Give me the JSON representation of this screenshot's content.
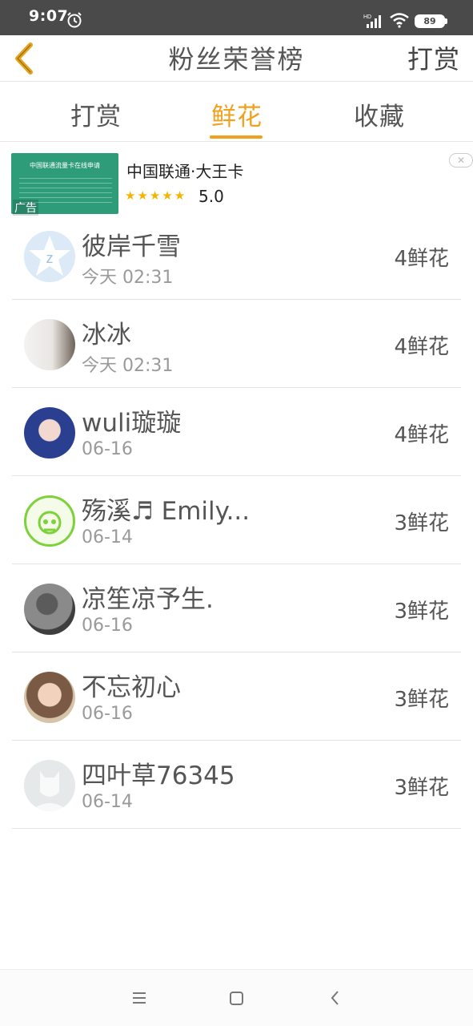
{
  "status_bar": {
    "time": "9:07",
    "network": "HD",
    "battery": "89"
  },
  "nav": {
    "back_icon": "chevron-left-icon",
    "title": "粉丝荣誉榜",
    "right_label": "打赏"
  },
  "tabs": [
    {
      "label": "打赏",
      "active": false
    },
    {
      "label": "鲜花",
      "active": true
    },
    {
      "label": "收藏",
      "active": false
    }
  ],
  "ad": {
    "title": "中国联通·大王卡",
    "stars": "★★★★★",
    "rating": "5.0",
    "badge": "广告",
    "image_heading": "中国联通流量卡在线申请"
  },
  "fans": [
    {
      "name": "彼岸千雪",
      "time": "今天 02:31",
      "count": "4鲜花"
    },
    {
      "name": "冰冰",
      "time": "今天 02:31",
      "count": "4鲜花"
    },
    {
      "name": "wuli璇璇",
      "time": "06-16",
      "count": "4鲜花"
    },
    {
      "name": "殇溪♬ Emily...",
      "time": "06-14",
      "count": "3鲜花"
    },
    {
      "name": "凉笙凉予生.",
      "time": "06-16",
      "count": "3鲜花"
    },
    {
      "name": "不忘初心",
      "time": "06-16",
      "count": "3鲜花"
    },
    {
      "name": "四叶草76345",
      "time": "06-14",
      "count": "3鲜花"
    }
  ],
  "colors": {
    "accent": "#f0a11e",
    "status_bar": "#4a4a4a"
  }
}
